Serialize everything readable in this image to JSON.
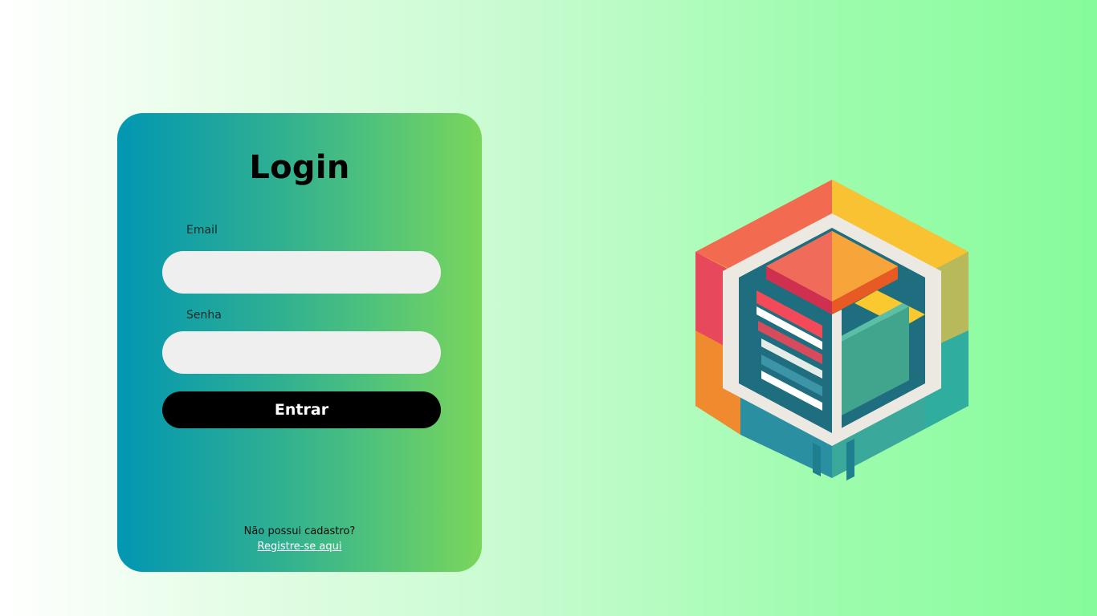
{
  "login": {
    "title": "Login",
    "email_label": "Email",
    "email_value": "",
    "password_label": "Senha",
    "password_value": "",
    "submit_label": "Entrar",
    "no_account_text": "Não possui cadastro?",
    "register_link": "Registre-se aqui"
  },
  "logo": {
    "icon": "isometric-cube-logo-icon"
  },
  "colors": {
    "card_gradient_start": "#0197b2",
    "card_gradient_end": "#7ad65b",
    "background_start": "#ffffff",
    "background_end": "#86fb9b",
    "button": "#000000",
    "input": "#efefef"
  }
}
